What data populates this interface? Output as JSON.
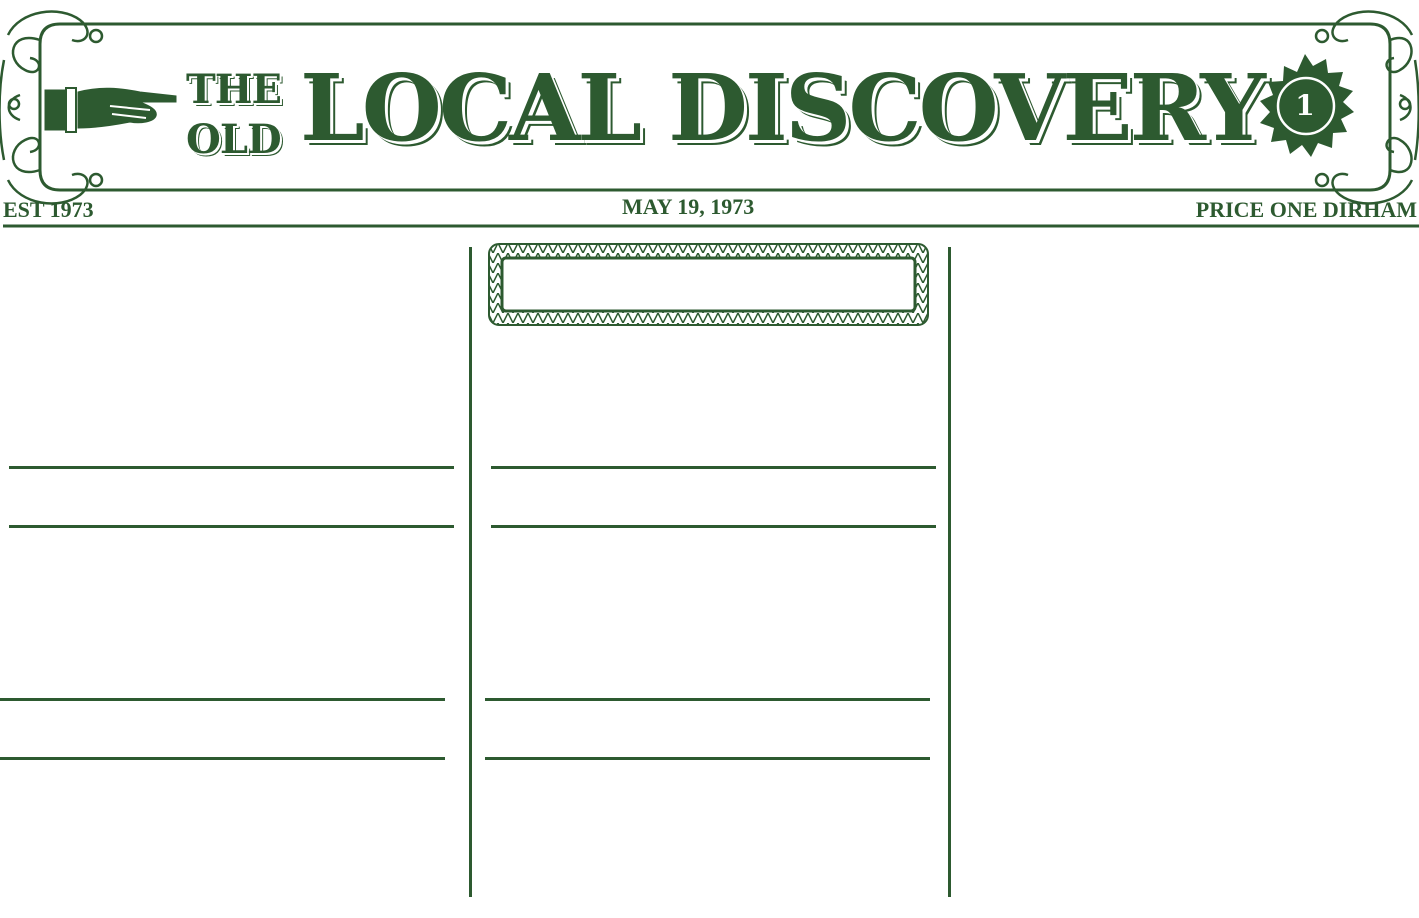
{
  "masthead": {
    "title_the": "THE",
    "title_old": "OLD",
    "title_main": "LOCAL DISCOVERY",
    "est": "EST 1973",
    "date": "MAY 19, 1973",
    "price": "PRICE ONE DIRHAM",
    "price_badge": "1"
  },
  "icons": {
    "pointing_hand": "pointing-hand-icon",
    "price_seal": "price-seal-icon",
    "flourish": "ornament-flourish-icon"
  },
  "colors": {
    "ink": "#2d5a30",
    "paper": "#ffffff"
  }
}
